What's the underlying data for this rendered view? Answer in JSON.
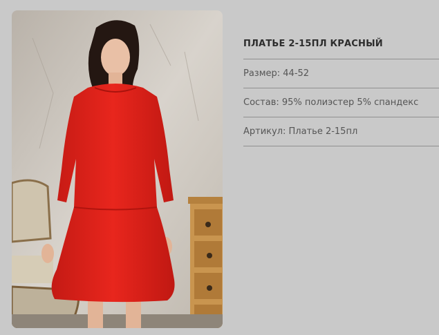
{
  "product": {
    "title": "ПЛАТЬЕ 2-15ПЛ КРАСНЫЙ",
    "image_subject": "model-in-red-dress",
    "attributes": [
      {
        "text": "Размер: 44-52"
      },
      {
        "text": "Состав: 95% полиэстер 5% спандекс"
      },
      {
        "text": "Артикул: Платье 2-15пл"
      }
    ]
  },
  "colors": {
    "background": "#c9c9c9",
    "dress": "#e0231c",
    "divider": "#8f8f8f",
    "title_text": "#2d2d2d",
    "body_text": "#555555"
  }
}
